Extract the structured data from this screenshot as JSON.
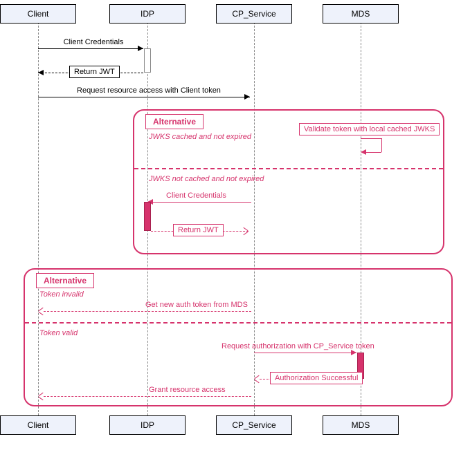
{
  "participants": {
    "client": "Client",
    "idp": "IDP",
    "cp": "CP_Service",
    "mds": "MDS"
  },
  "messages": {
    "client_creds_1": "Client Credentials",
    "return_jwt_1": "Return JWT",
    "req_access": "Request resource access with Client token",
    "alt1_title": "Alternative",
    "alt1_guard1": "JWKS cached and not expired",
    "validate_cached": "Validate token with local cached JWKS",
    "alt1_guard2": "JWKS not cached and not expired",
    "client_creds_2": "Client Credentials",
    "return_jwt_2": "Return JWT",
    "alt2_title": "Alternative",
    "alt2_guard1": "Token invalid",
    "get_new_token": "Get new auth token from MDS",
    "alt2_guard2": "Token valid",
    "req_auth": "Request authorization with CP_Service token",
    "auth_success": "Authorization Successful",
    "grant_access": "Grant resource access"
  }
}
